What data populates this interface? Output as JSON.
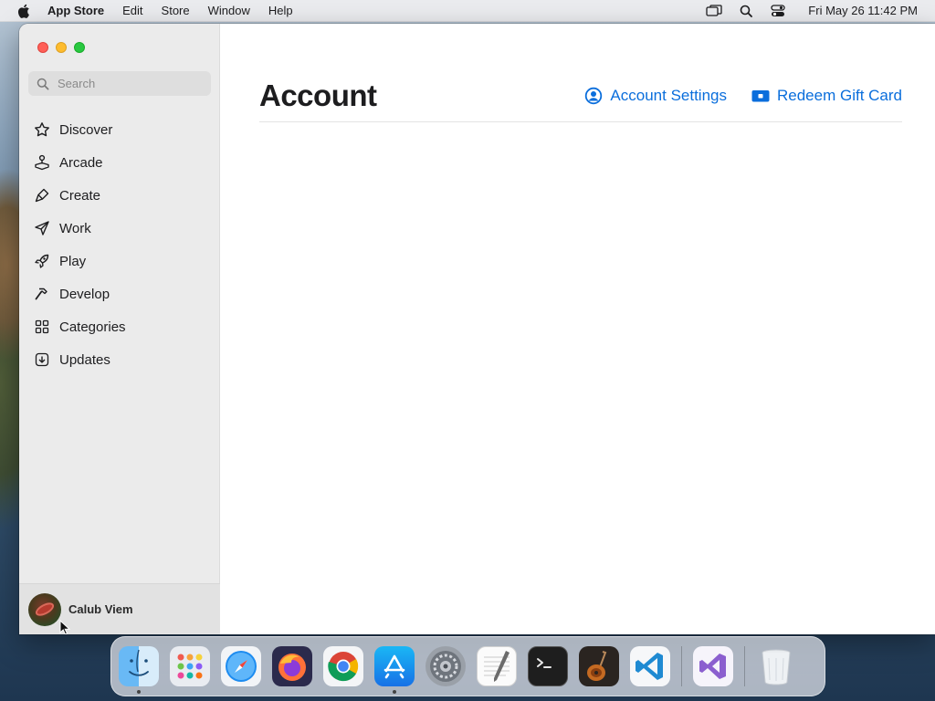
{
  "menubar": {
    "apple_icon": "apple-icon",
    "app_name": "App Store",
    "menus": [
      "Edit",
      "Store",
      "Window",
      "Help"
    ],
    "status_icons": [
      "screen-mirroring-icon",
      "spotlight-icon",
      "control-center-icon"
    ],
    "clock": "Fri May 26  11:42 PM"
  },
  "window": {
    "traffic_lights": [
      "close",
      "minimize",
      "zoom"
    ]
  },
  "sidebar": {
    "search": {
      "placeholder": "Search",
      "icon": "magnifier-icon"
    },
    "items": [
      {
        "label": "Discover",
        "icon": "star-icon"
      },
      {
        "label": "Arcade",
        "icon": "joystick-icon"
      },
      {
        "label": "Create",
        "icon": "brush-icon"
      },
      {
        "label": "Work",
        "icon": "paperplane-icon"
      },
      {
        "label": "Play",
        "icon": "rocket-icon"
      },
      {
        "label": "Develop",
        "icon": "hammer-icon"
      },
      {
        "label": "Categories",
        "icon": "grid-icon"
      },
      {
        "label": "Updates",
        "icon": "download-icon"
      }
    ],
    "profile": {
      "name": "Calub Viem",
      "avatar": "avatar-image"
    }
  },
  "main": {
    "title": "Account",
    "actions": [
      {
        "label": "Account Settings",
        "icon": "person-circle-icon"
      },
      {
        "label": "Redeem Gift Card",
        "icon": "gift-card-icon"
      }
    ],
    "accent_color": "#0a6edc"
  },
  "dock": {
    "apps": [
      {
        "name": "Finder",
        "icon": "finder-icon",
        "running": true
      },
      {
        "name": "Launchpad",
        "icon": "launchpad-icon",
        "running": false
      },
      {
        "name": "Safari",
        "icon": "safari-icon",
        "running": false
      },
      {
        "name": "Firefox",
        "icon": "firefox-icon",
        "running": false
      },
      {
        "name": "Google Chrome",
        "icon": "chrome-icon",
        "running": false
      },
      {
        "name": "App Store",
        "icon": "app-store-icon",
        "running": true
      },
      {
        "name": "System Preferences",
        "icon": "system-preferences-icon",
        "running": false
      },
      {
        "name": "TextEdit",
        "icon": "textedit-icon",
        "running": false
      },
      {
        "name": "Terminal",
        "icon": "terminal-icon",
        "running": false
      },
      {
        "name": "GarageBand",
        "icon": "garageband-icon",
        "running": false
      },
      {
        "name": "Visual Studio Code",
        "icon": "vscode-icon",
        "running": false
      },
      {
        "name": "Visual Studio",
        "icon": "visual-studio-icon",
        "running": false
      },
      {
        "name": "Trash",
        "icon": "trash-icon",
        "running": false
      }
    ]
  }
}
